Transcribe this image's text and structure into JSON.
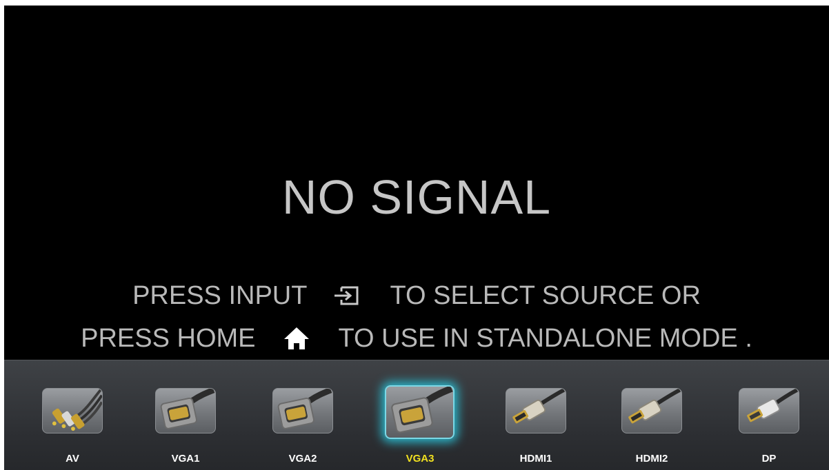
{
  "message": {
    "title": "NO SIGNAL",
    "line1_before": "PRESS INPUT",
    "line1_icon": "input-source-icon",
    "line1_after": "TO SELECT SOURCE OR",
    "line2_before": "PRESS HOME",
    "line2_icon": "home-icon",
    "line2_after": "TO USE IN STANDALONE MODE ."
  },
  "sources": [
    {
      "label": "AV",
      "icon": "av-rca-cable-icon",
      "selected": false
    },
    {
      "label": "VGA1",
      "icon": "vga-connector-icon",
      "selected": false
    },
    {
      "label": "VGA2",
      "icon": "vga-connector-icon",
      "selected": false
    },
    {
      "label": "VGA3",
      "icon": "vga-connector-icon",
      "selected": true
    },
    {
      "label": "HDMI1",
      "icon": "hdmi-connector-icon",
      "selected": false
    },
    {
      "label": "HDMI2",
      "icon": "hdmi-connector-icon",
      "selected": false
    },
    {
      "label": "DP",
      "icon": "displayport-connector-icon",
      "selected": false
    }
  ],
  "colors": {
    "background": "#000000",
    "text": "#c6c6c6",
    "selected_label": "#f0e020",
    "selection_glow": "#2bb4c8"
  }
}
